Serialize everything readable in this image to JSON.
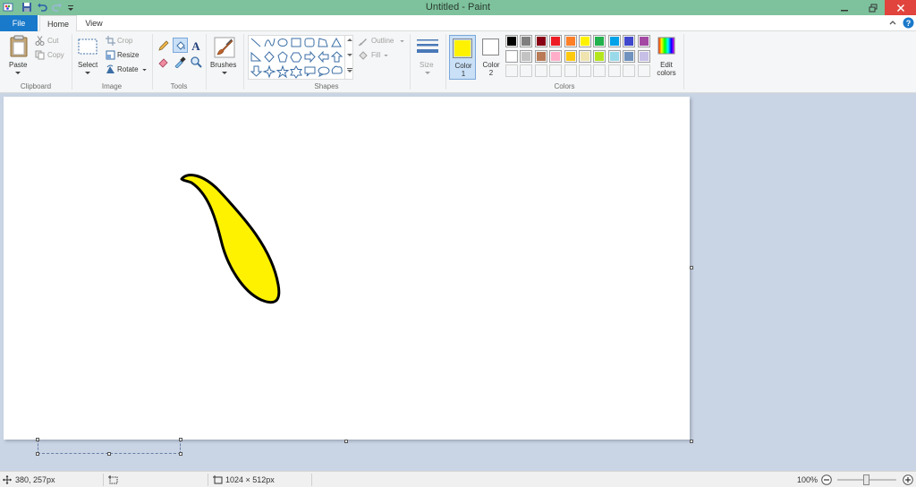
{
  "window": {
    "title": "Untitled - Paint"
  },
  "tabs": {
    "file": "File",
    "home": "Home",
    "view": "View"
  },
  "clipboard": {
    "paste": "Paste",
    "cut": "Cut",
    "copy": "Copy",
    "group": "Clipboard"
  },
  "image": {
    "select": "Select",
    "crop": "Crop",
    "resize": "Resize",
    "rotate": "Rotate",
    "group": "Image"
  },
  "tools": {
    "group": "Tools"
  },
  "brushes": {
    "label": "Brushes"
  },
  "shapes": {
    "outline": "Outline",
    "fill": "Fill",
    "group": "Shapes"
  },
  "size": {
    "label": "Size"
  },
  "colors": {
    "color1_label": "Color\n1",
    "color2_label": "Color\n2",
    "color1": "#fff200",
    "color2": "#ffffff",
    "edit": "Edit\ncolors",
    "group": "Colors",
    "palette_row1": [
      "#000000",
      "#7f7f7f",
      "#880015",
      "#ed1c24",
      "#ff7f27",
      "#fff200",
      "#22b14c",
      "#00a2e8",
      "#3f48cc",
      "#a349a4"
    ],
    "palette_row2": [
      "#ffffff",
      "#c3c3c3",
      "#b97a57",
      "#ffaec9",
      "#ffc90e",
      "#efe4b0",
      "#b5e61d",
      "#99d9ea",
      "#7092be",
      "#c8bfe7"
    ]
  },
  "status": {
    "cursor": "380, 257px",
    "canvas_size": "1024 × 512px",
    "zoom": "100%"
  }
}
